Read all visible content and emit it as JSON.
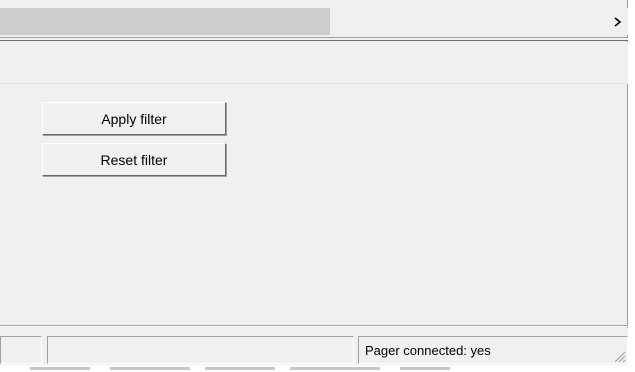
{
  "scrollbar": {
    "position": 0.52,
    "arrow_icon": "chevron-right-icon"
  },
  "filter": {
    "apply_label": "Apply filter",
    "reset_label": "Reset filter"
  },
  "statusbar": {
    "pane1": "",
    "pane2": "",
    "pager_status": "Pager connected: yes"
  }
}
